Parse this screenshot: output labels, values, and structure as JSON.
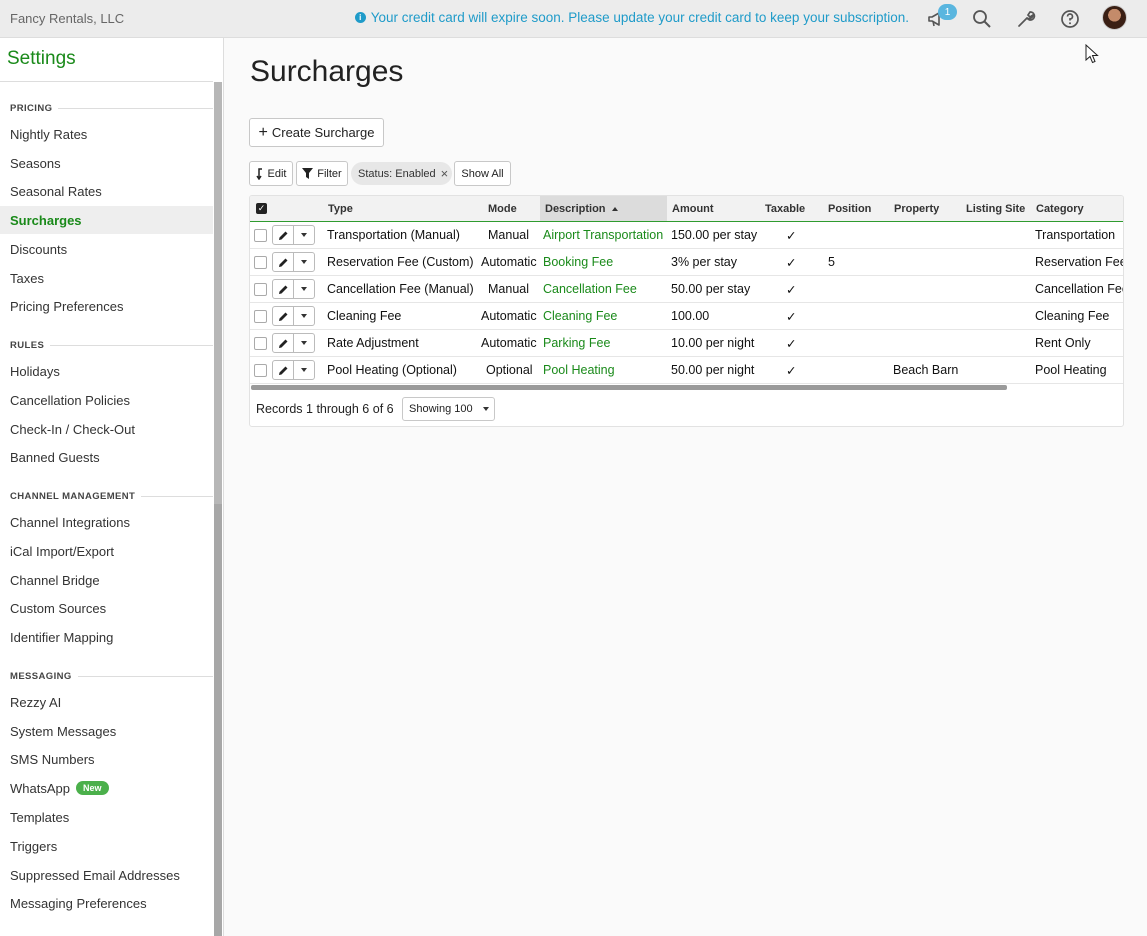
{
  "topbar": {
    "company": "Fancy Rentals, LLC",
    "banner_icon": "info-icon",
    "banner": "Your credit card will expire soon. Please update your credit card to keep your subscription.",
    "notification_count": "1",
    "icons": [
      "megaphone-icon",
      "search-icon",
      "wrench-icon",
      "help-icon",
      "avatar"
    ],
    "banner_color": "#1f9bc9"
  },
  "sidebar": {
    "title": "Settings",
    "accent_color": "#1a8a1a",
    "sections": [
      {
        "heading": "PRICING",
        "items": [
          "Nightly Rates",
          "Seasons",
          "Seasonal Rates",
          "Surcharges",
          "Discounts",
          "Taxes",
          "Pricing Preferences"
        ]
      },
      {
        "heading": "RULES",
        "items": [
          "Holidays",
          "Cancellation Policies",
          "Check-In / Check-Out",
          "Banned Guests"
        ]
      },
      {
        "heading": "CHANNEL MANAGEMENT",
        "items": [
          "Channel Integrations",
          "iCal Import/Export",
          "Channel Bridge",
          "Custom Sources",
          "Identifier Mapping"
        ]
      },
      {
        "heading": "MESSAGING",
        "items": [
          "Rezzy AI",
          "System Messages",
          "SMS Numbers",
          "WhatsApp",
          "Templates",
          "Triggers",
          "Suppressed Email Addresses",
          "Messaging Preferences"
        ]
      }
    ],
    "active_item": "Surcharges",
    "new_badge": "New"
  },
  "main": {
    "title": "Surcharges",
    "create_button": "Create Surcharge",
    "edit_button": "Edit",
    "filter_button": "Filter",
    "status_chip": "Status: Enabled",
    "show_all_button": "Show All"
  },
  "table": {
    "columns": [
      "Type",
      "Mode",
      "Description",
      "Amount",
      "Taxable",
      "Position",
      "Property",
      "Listing Site",
      "Category"
    ],
    "sorted_column": "Description",
    "sort_direction": "ascending",
    "rows": [
      {
        "type": "Transportation (Manual)",
        "mode": "Manual",
        "description": "Airport Transportation",
        "amount": "150.00 per stay",
        "taxable": "✓",
        "position": "",
        "property": "",
        "listing_site": "",
        "category": "Transportation"
      },
      {
        "type": "Reservation Fee (Custom)",
        "mode": "Automatic",
        "description": "Booking Fee",
        "amount": "3% per stay",
        "taxable": "✓",
        "position": "5",
        "property": "",
        "listing_site": "",
        "category": "Reservation Fee"
      },
      {
        "type": "Cancellation Fee (Manual)",
        "mode": "Manual",
        "description": "Cancellation Fee",
        "amount": "50.00 per stay",
        "taxable": "✓",
        "position": "",
        "property": "",
        "listing_site": "",
        "category": "Cancellation Fee"
      },
      {
        "type": "Cleaning Fee",
        "mode": "Automatic",
        "description": "Cleaning Fee",
        "amount": "100.00",
        "taxable": "✓",
        "position": "",
        "property": "",
        "listing_site": "",
        "category": "Cleaning Fee"
      },
      {
        "type": "Rate Adjustment",
        "mode": "Automatic",
        "description": "Parking Fee",
        "amount": "10.00 per night",
        "taxable": "✓",
        "position": "",
        "property": "",
        "listing_site": "",
        "category": "Rent Only"
      },
      {
        "type": "Pool Heating (Optional)",
        "mode": "Optional",
        "description": "Pool Heating",
        "amount": "50.00 per night",
        "taxable": "✓",
        "position": "",
        "property": "Beach Barn",
        "listing_site": "",
        "category": "Pool Heating"
      }
    ],
    "records_text": "Records 1 through 6 of 6",
    "page_size_select": "Showing 100"
  }
}
